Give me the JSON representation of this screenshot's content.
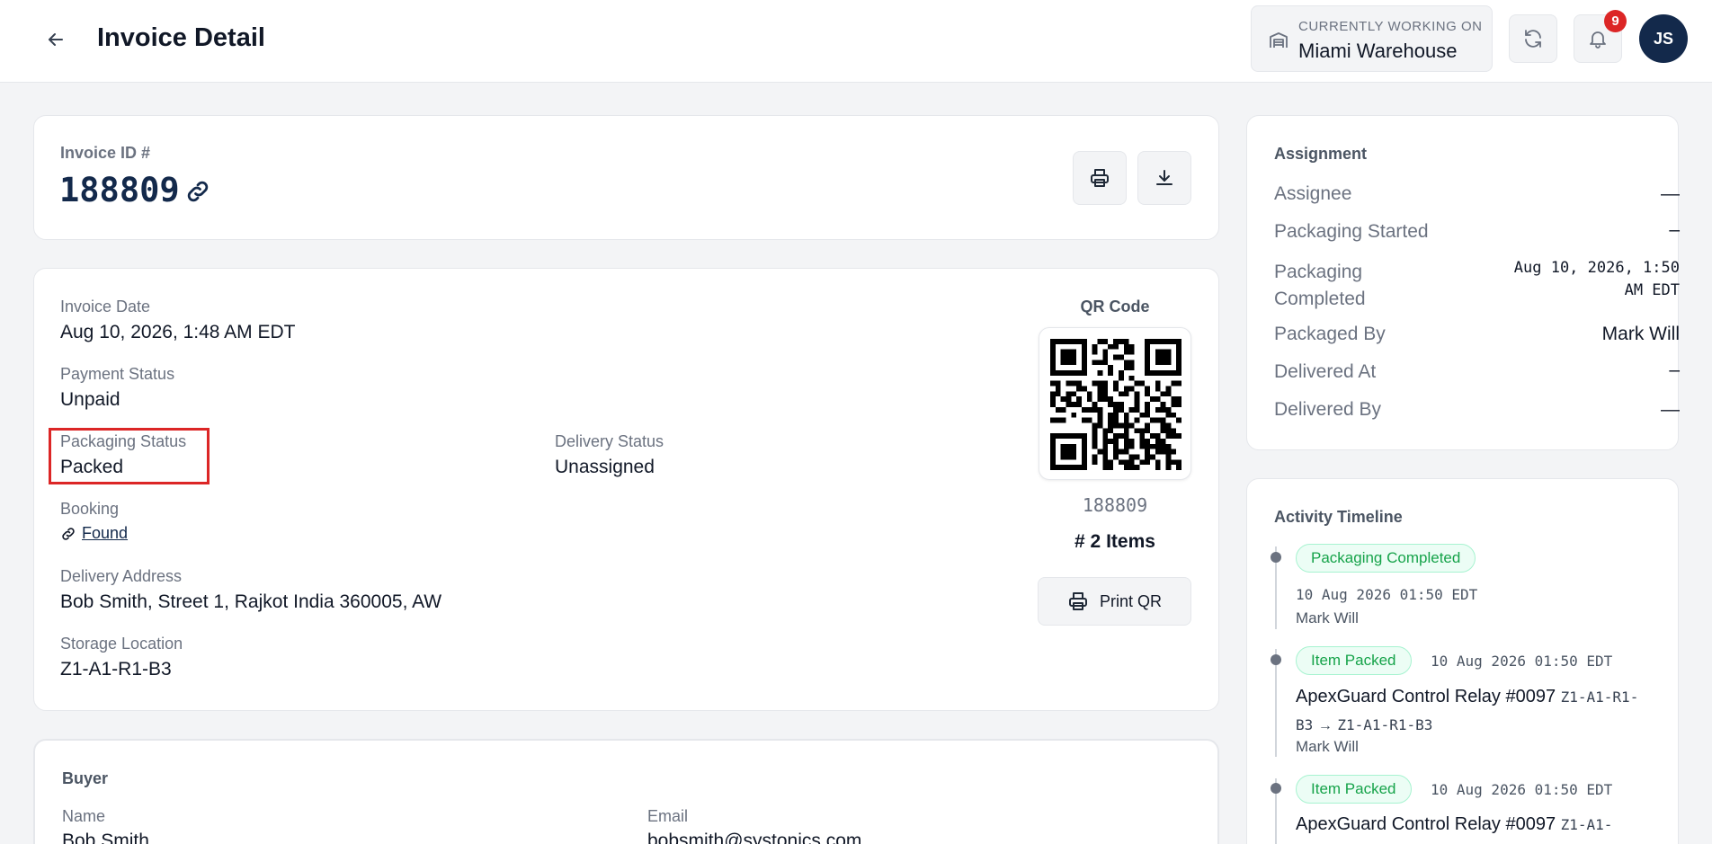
{
  "header": {
    "title": "Invoice Detail",
    "warehouse_label": "CURRENTLY WORKING ON",
    "warehouse_name": "Miami Warehouse",
    "notification_count": "9",
    "avatar_initials": "JS"
  },
  "invoice": {
    "id_label": "Invoice ID #",
    "id": "188809"
  },
  "details": {
    "invoice_date_label": "Invoice Date",
    "invoice_date": "Aug 10, 2026, 1:48 AM EDT",
    "payment_status_label": "Payment Status",
    "payment_status": "Unpaid",
    "packaging_status_label": "Packaging Status",
    "packaging_status": "Packed",
    "delivery_status_label": "Delivery Status",
    "delivery_status": "Unassigned",
    "booking_label": "Booking",
    "booking_link": "Found",
    "delivery_address_label": "Delivery Address",
    "delivery_address": "Bob Smith, Street 1, Rajkot India 360005, AW",
    "storage_location_label": "Storage Location",
    "storage_location": "Z1-A1-R1-B3"
  },
  "qr": {
    "label": "QR Code",
    "code": "188809",
    "items": "# 2 Items",
    "print_label": "Print QR"
  },
  "buyer": {
    "title": "Buyer",
    "name_label": "Name",
    "name": "Bob Smith",
    "email_label": "Email",
    "email": "bobsmith@systonics.com"
  },
  "assignment": {
    "title": "Assignment",
    "rows": [
      {
        "label": "Assignee",
        "value": "—"
      },
      {
        "label": "Packaging Started",
        "value": "–"
      },
      {
        "label": "Packaging Completed",
        "value": "Aug 10, 2026, 1:50 AM EDT"
      },
      {
        "label": "Packaged By",
        "value": "Mark Will"
      },
      {
        "label": "Delivered At",
        "value": "–"
      },
      {
        "label": "Delivered By",
        "value": "—"
      }
    ]
  },
  "timeline": {
    "title": "Activity Timeline",
    "events": [
      {
        "badge": "Packaging Completed",
        "time": "10 Aug 2026 01:50 EDT",
        "user": "Mark Will"
      },
      {
        "badge": "Item Packed",
        "time": "10 Aug 2026 01:50 EDT",
        "item": "ApexGuard Control Relay #0097",
        "loc_from": "Z1-A1-R1-B3",
        "arrow": "→",
        "loc_to": "Z1-A1-R1-B3",
        "user": "Mark Will"
      },
      {
        "badge": "Item Packed",
        "time": "10 Aug 2026 01:50 EDT",
        "item": "ApexGuard Control Relay #0097",
        "loc_from": "Z1-A1-"
      }
    ]
  },
  "colors": {
    "accent_navy": "#13294b",
    "badge_red": "#dc2626",
    "success_green": "#16a34a"
  }
}
